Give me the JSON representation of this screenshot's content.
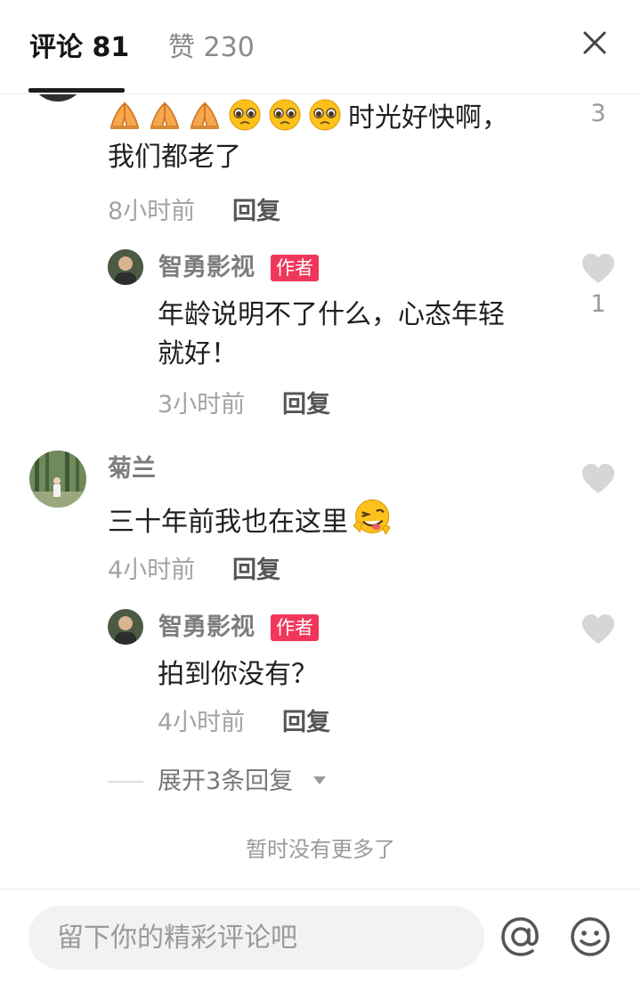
{
  "header": {
    "comments_tab": "评论 81",
    "likes_tab": "赞 230"
  },
  "comments": [
    {
      "text_line1": "时光好快啊，",
      "text_line2": "我们都老了",
      "emojis": [
        "folded-hands-emoji",
        "folded-hands-emoji",
        "folded-hands-emoji",
        "pleading-face-emoji",
        "pleading-face-emoji",
        "pleading-face-emoji"
      ],
      "time": "8小时前",
      "reply_label": "回复",
      "likes": "3",
      "replies": [
        {
          "name": "智勇影视",
          "tag": "作者",
          "text_line1": "年龄说明不了什么，心态年轻",
          "text_line2": "就好！",
          "time": "3小时前",
          "reply_label": "回复",
          "likes": "1"
        }
      ]
    },
    {
      "name": "菊兰",
      "text": "三十年前我也在这里",
      "emojis": [
        "winking-tongue-face-emoji"
      ],
      "time": "4小时前",
      "reply_label": "回复",
      "replies": [
        {
          "name": "智勇影视",
          "tag": "作者",
          "text": "拍到你没有？",
          "time": "4小时前",
          "reply_label": "回复"
        }
      ],
      "expand_replies": "展开3条回复"
    }
  ],
  "no_more": "暂时没有更多了",
  "footer": {
    "input_placeholder": "留下你的精彩评论吧"
  },
  "colors": {
    "author_tag": "#f0375a",
    "heart": "#d6d6d6"
  }
}
